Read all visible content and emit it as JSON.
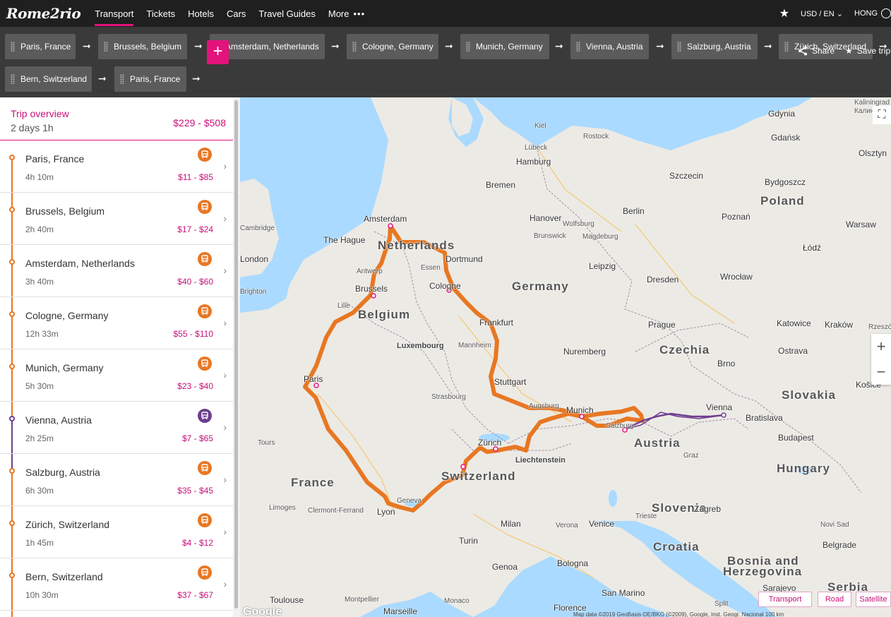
{
  "nav": {
    "logo": "Rome2rio",
    "links": [
      "Transport",
      "Tickets",
      "Hotels",
      "Cars",
      "Travel Guides",
      "More"
    ],
    "more_dots": "•••",
    "currency": "USD / EN",
    "user": "HONG"
  },
  "route": {
    "stops": [
      "Paris, France",
      "Brussels, Belgium",
      "Amsterdam, Netherlands",
      "Cologne, Germany",
      "Munich, Germany",
      "Vienna, Austria",
      "Salzburg, Austria",
      "Zürich, Switzerland",
      "Bern, Switzerland",
      "Paris, France"
    ],
    "add_label": "+",
    "share_label": "Share",
    "save_label": "Save trip"
  },
  "overview": {
    "title": "Trip overview",
    "duration": "2 days 1h",
    "price": "$229 - $508"
  },
  "legs": [
    {
      "name": "Paris, France",
      "duration": "4h 10m",
      "price": "$11 - $85",
      "mode": "bus"
    },
    {
      "name": "Brussels, Belgium",
      "duration": "2h 40m",
      "price": "$17 - $24",
      "mode": "bus"
    },
    {
      "name": "Amsterdam, Netherlands",
      "duration": "3h 40m",
      "price": "$40 - $60",
      "mode": "bus"
    },
    {
      "name": "Cologne, Germany",
      "duration": "12h 33m",
      "price": "$55 - $110",
      "mode": "bus"
    },
    {
      "name": "Munich, Germany",
      "duration": "5h 30m",
      "price": "$23 - $40",
      "mode": "bus"
    },
    {
      "name": "Vienna, Austria",
      "duration": "2h 25m",
      "price": "$7 - $65",
      "mode": "train"
    },
    {
      "name": "Salzburg, Austria",
      "duration": "6h 30m",
      "price": "$35 - $45",
      "mode": "bus"
    },
    {
      "name": "Zürich, Switzerland",
      "duration": "1h 45m",
      "price": "$4 - $12",
      "mode": "bus"
    },
    {
      "name": "Bern, Switzerland",
      "duration": "10h 30m",
      "price": "$37 - $67",
      "mode": "bus"
    }
  ],
  "colors": {
    "accent": "#e4127b",
    "bus": "#e87722",
    "train": "#6e3d8e"
  },
  "map": {
    "countries": [
      "Poland",
      "Germany",
      "Czechia",
      "Slovakia",
      "Austria",
      "Hungary",
      "France",
      "Switzerland",
      "Belgium",
      "Netherlands",
      "Croatia",
      "Bosnia and",
      "Herzegovina",
      "Serbia",
      "Slovenia",
      "Liechtenstein",
      "Luxembourg"
    ],
    "cities": [
      "Gdynia",
      "Gdańsk",
      "Kaliningrad",
      "Калининград",
      "Olsztyn",
      "Kiel",
      "Rostock",
      "Lübeck",
      "Hamburg",
      "Szczecin",
      "Bydgoszcz",
      "Bremen",
      "Berlin",
      "Poznań",
      "Warsaw",
      "Amsterdam",
      "Hanover",
      "Wolfsburg",
      "Brunswick",
      "Magdeburg",
      "Łódź",
      "The Hague",
      "Dortmund",
      "Essen",
      "Leipzig",
      "Wrocław",
      "Antwerp",
      "Brussels",
      "Cologne",
      "Dresden",
      "Lille",
      "Frankfurt",
      "Prague",
      "Katowice",
      "Kraków",
      "Mannheim",
      "Nuremberg",
      "Ostrava",
      "Paris",
      "Stuttgart",
      "Brno",
      "Košice",
      "Strasbourg",
      "Augsburg",
      "Munich",
      "Vienna",
      "Bratislava",
      "Salzburg",
      "Zürich",
      "Budapest",
      "Tours",
      "Graz",
      "Limoges",
      "Clermont-Ferrand",
      "Lyon",
      "Geneva",
      "Milan",
      "Venice",
      "Zagreb",
      "Verona",
      "Trieste",
      "Turin",
      "Bologna",
      "Novi Sad",
      "Belgrade",
      "Genoa",
      "Toulouse",
      "Monaco",
      "San Marino",
      "Montpellier",
      "Marseille",
      "Florence",
      "Sarajevo",
      "Split",
      "Cambridge",
      "London",
      "Brighton",
      "Rzeszów"
    ],
    "map_types": [
      "Transport",
      "Road",
      "Satellite"
    ],
    "zoom_in": "+",
    "zoom_out": "−",
    "attribution": "Map data ©2019 GeoBasis-DE/BKG (©2009), Google, Inst. Geogr. Nacional   100 km",
    "google": "Google"
  }
}
